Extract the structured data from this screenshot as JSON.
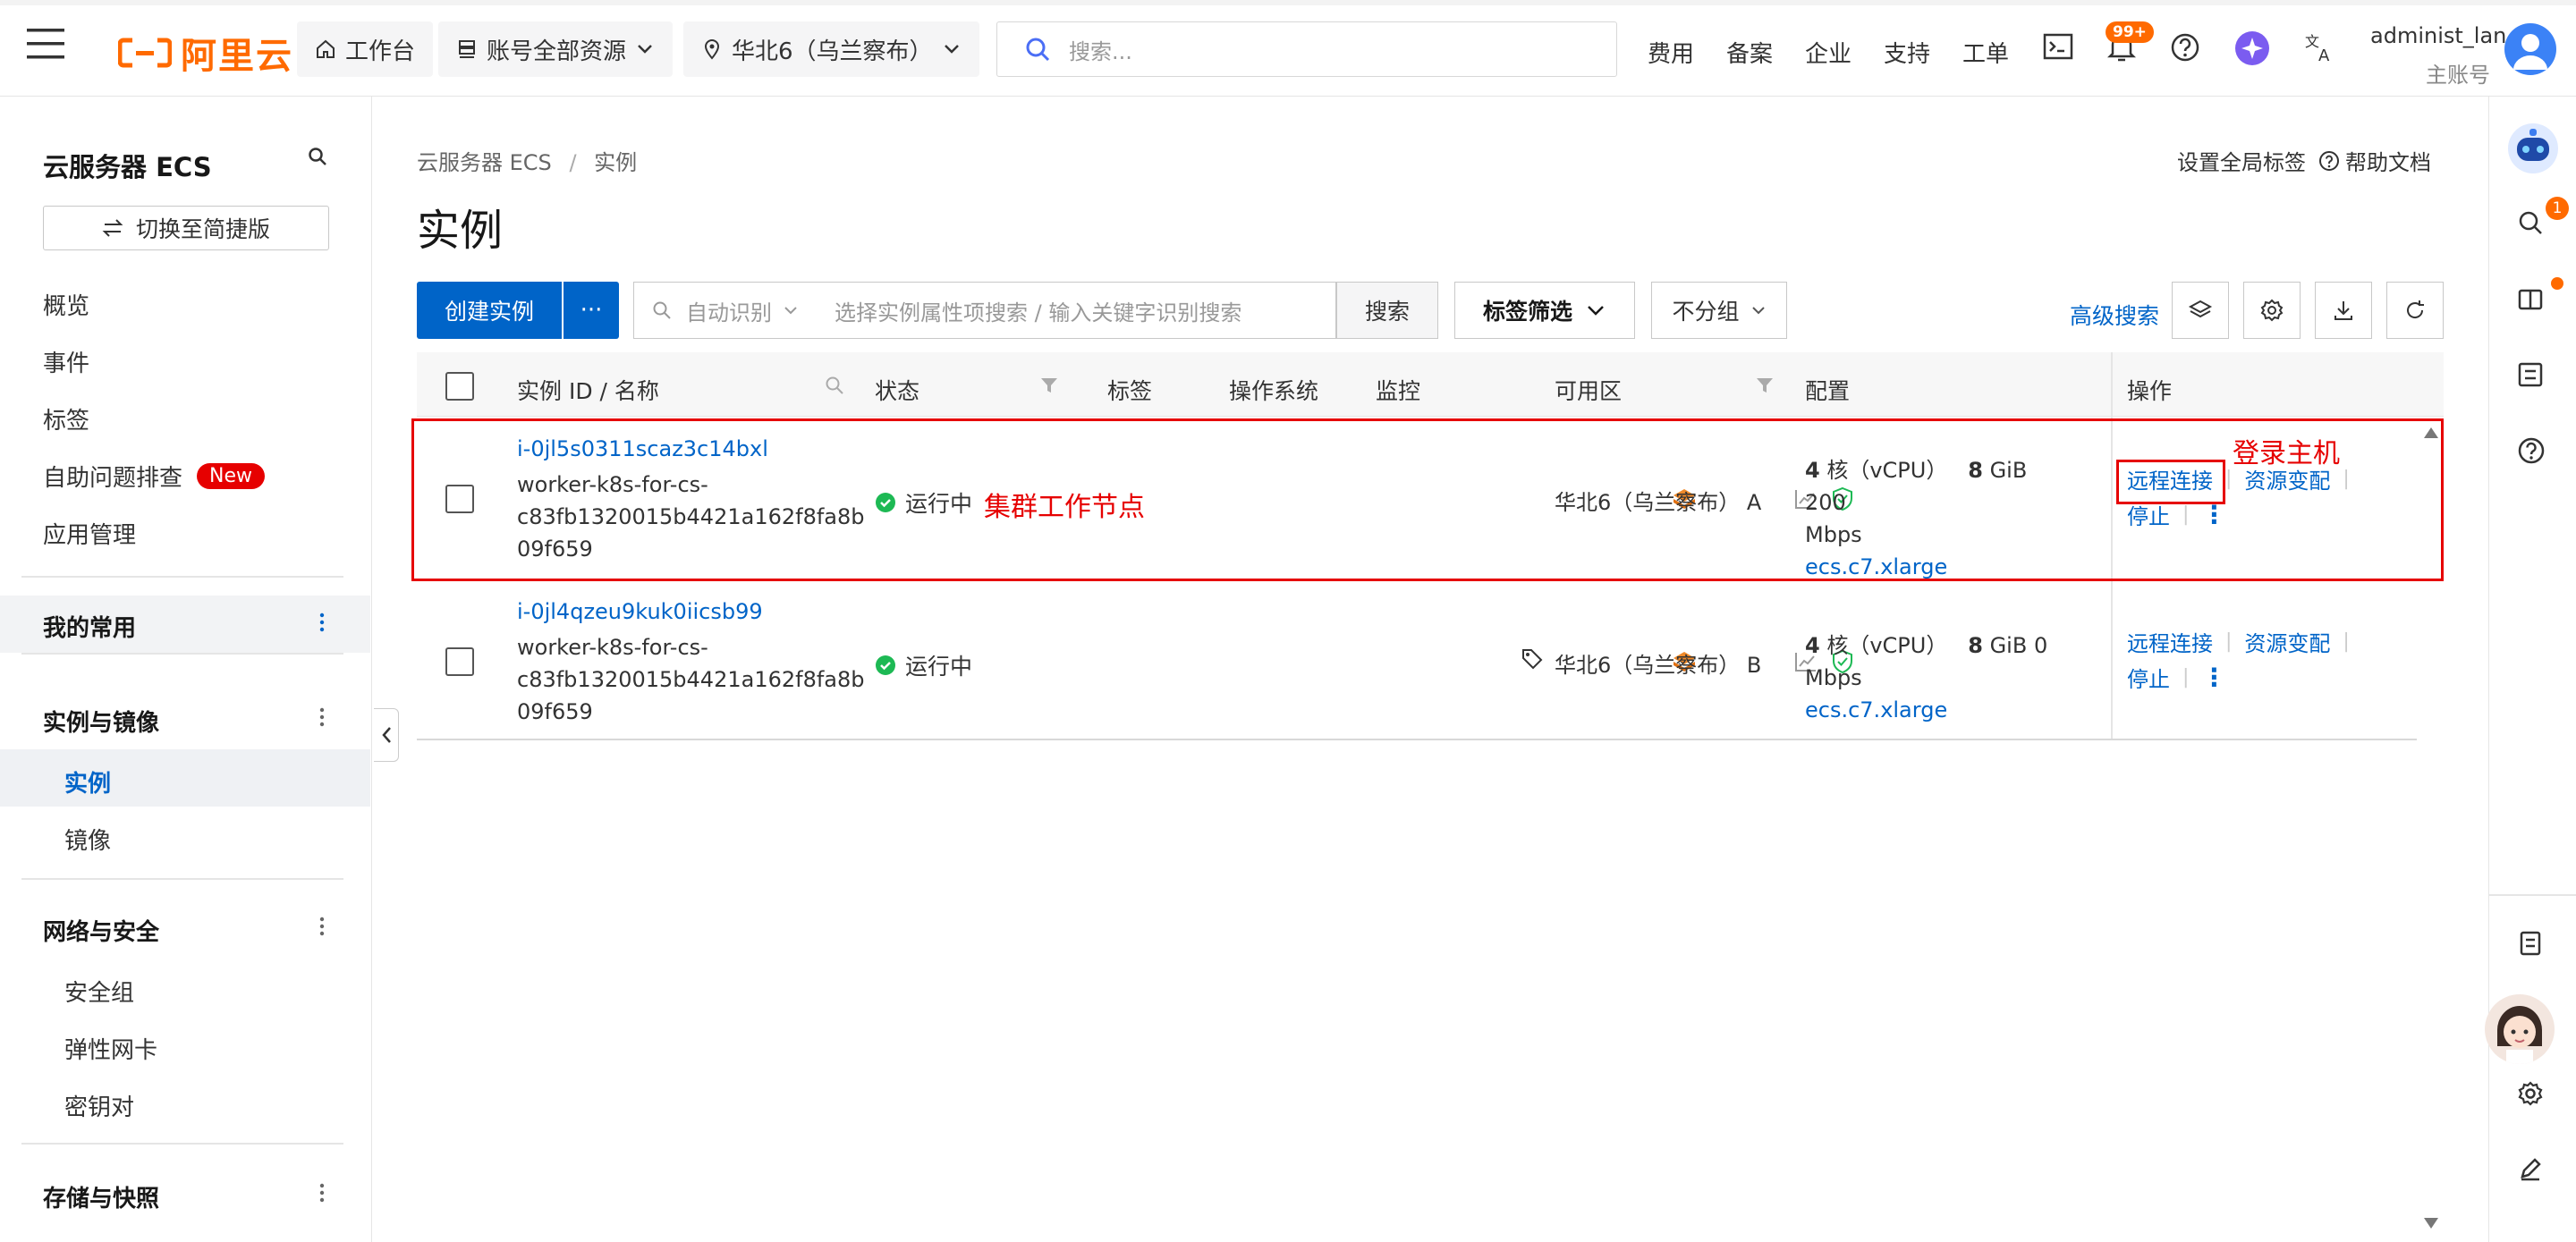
{
  "topbar": {
    "brand": "阿里云",
    "workbench": "工作台",
    "resources": "账号全部资源",
    "region": "华北6（乌兰察布）",
    "search_placeholder": "搜索...",
    "nav": [
      "费用",
      "备案",
      "企业",
      "支持",
      "工单"
    ],
    "notification_count": "99+",
    "user_name": "administ_lan",
    "user_role": "主账号"
  },
  "sidebar": {
    "title": "云服务器 ECS",
    "switch_label": "切换至简捷版",
    "items": [
      "概览",
      "事件",
      "标签",
      "自助问题排查",
      "应用管理"
    ],
    "new_badge": "New",
    "groups": {
      "favorites": "我的常用",
      "instances_images": "实例与镜像",
      "instance": "实例",
      "image": "镜像",
      "network_security": "网络与安全",
      "security_group": "安全组",
      "eni": "弹性网卡",
      "keypair": "密钥对",
      "storage": "存储与快照"
    }
  },
  "main": {
    "breadcrumb_root": "云服务器 ECS",
    "breadcrumb_sep": "/",
    "breadcrumb_current": "实例",
    "title": "实例",
    "global_tags": "设置全局标签",
    "help_docs": "帮助文档",
    "create_btn": "创建实例",
    "create_more": "···",
    "auto_detect": "自动识别",
    "filter_placeholder": "选择实例属性项搜索 / 输入关键字识别搜索",
    "search_btn": "搜索",
    "tag_filter": "标签筛选",
    "group_select": "不分组",
    "advanced_search": "高级搜索"
  },
  "table": {
    "headers": {
      "id_name": "实例 ID / 名称",
      "status": "状态",
      "tags": "标签",
      "os": "操作系统",
      "monitor": "监控",
      "zone": "可用区",
      "config": "配置",
      "actions": "操作"
    },
    "rows": [
      {
        "id": "i-0jl5s0311scaz3c14bxl",
        "name_l1": "worker-k8s-for-cs-",
        "name_l2": "c83fb1320015b4421a162f8fa8b",
        "name_l3": "09f659",
        "status": "运行中",
        "zone": "华北6（乌兰察布） A",
        "cpu_num": "4",
        "cpu_txt": "核（vCPU）",
        "mem_num": "8",
        "mem_txt": "GiB 200",
        "bw_txt": "Mbps",
        "spec": "ecs.c7.xlarge",
        "remote": "远程连接",
        "resize": "资源变配",
        "stop": "停止",
        "more": "⋮"
      },
      {
        "id": "i-0jl4qzeu9kuk0iicsb99",
        "name_l1": "worker-k8s-for-cs-",
        "name_l2": "c83fb1320015b4421a162f8fa8b",
        "name_l3": "09f659",
        "status": "运行中",
        "zone": "华北6（乌兰察布） B",
        "cpu_num": "4",
        "cpu_txt": "核（vCPU）",
        "mem_num": "8",
        "mem_txt": "GiB 0 Mbps",
        "spec": "ecs.c7.xlarge",
        "remote": "远程连接",
        "resize": "资源变配",
        "stop": "停止",
        "more": "⋮"
      }
    ]
  },
  "annotations": {
    "worker_node": "集群工作节点",
    "login_host": "登录主机"
  },
  "colors": {
    "brand_orange": "#ff6a00",
    "primary_blue": "#0064c8",
    "annotation_red": "#e60000",
    "status_green": "#1db954"
  }
}
